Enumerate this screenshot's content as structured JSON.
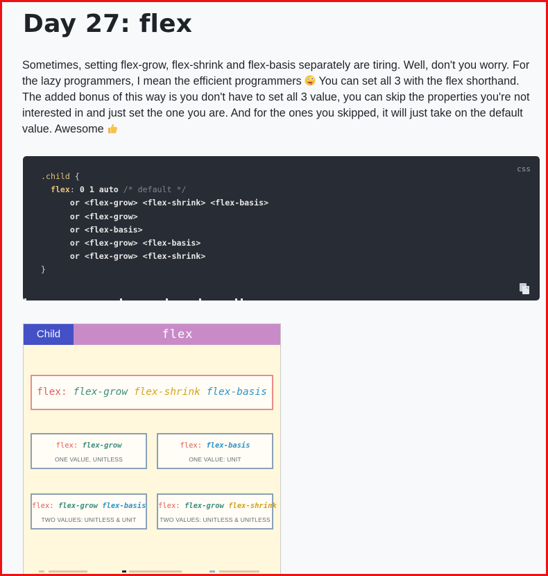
{
  "heading": "Day 27: flex",
  "intro": {
    "part1": "Sometimes, setting flex-grow, flex-shrink and flex-basis separately are tiring. Well, don't you worry. For the lazy programmers, I mean the efficient programmers",
    "part2": "You can set all 3 with the flex shorthand. The added bonus of this way is you don't have to set all 3 value, you can skip the properties you're not interested in and just set the one you are. And for the ones you skipped, it will just take on the default value. Awesome",
    "emoji1": "zany-face-icon",
    "emoji2": "thumbs-up-icon"
  },
  "code": {
    "lang": "css",
    "selector": ".child",
    "open_brace": "{",
    "property": "flex",
    "colon": ":",
    "value": "0 1 auto",
    "comment": "/* default */",
    "lines": [
      "or <flex-grow> <flex-shrink> <flex-basis>",
      "or <flex-grow>",
      "or <flex-basis>",
      "or <flex-grow> <flex-basis>",
      "or <flex-grow> <flex-shrink>"
    ],
    "close_brace": "}",
    "copy_icon": "copy-icon"
  },
  "figure": {
    "tag_child": "Child",
    "tag_flex": "flex",
    "main": {
      "prop": "flex:",
      "grow": "flex-grow",
      "shrink": "flex-shrink",
      "basis": "flex-basis"
    },
    "boxes": [
      {
        "prop": "flex:",
        "a": "flex-grow",
        "b": "",
        "caption": "ONE VALUE, UNITLESS"
      },
      {
        "prop": "flex:",
        "a": "flex-basis",
        "b": "",
        "caption": "ONE VALUE: UNIT"
      },
      {
        "prop": "flex:",
        "a": "flex-grow",
        "b": "flex-basis",
        "caption": "TWO VALUES: UNITLESS & UNIT"
      },
      {
        "prop": "flex:",
        "a": "flex-grow",
        "b": "flex-shrink",
        "caption": "TWO VALUES: UNITLESS & UNITLESS"
      }
    ]
  },
  "colors": {
    "code_bg": "#282c34",
    "child_tag": "#4450c6",
    "flex_tag": "#c98bc8",
    "card_bg": "#fff8dc",
    "frame": "#ee1111"
  }
}
